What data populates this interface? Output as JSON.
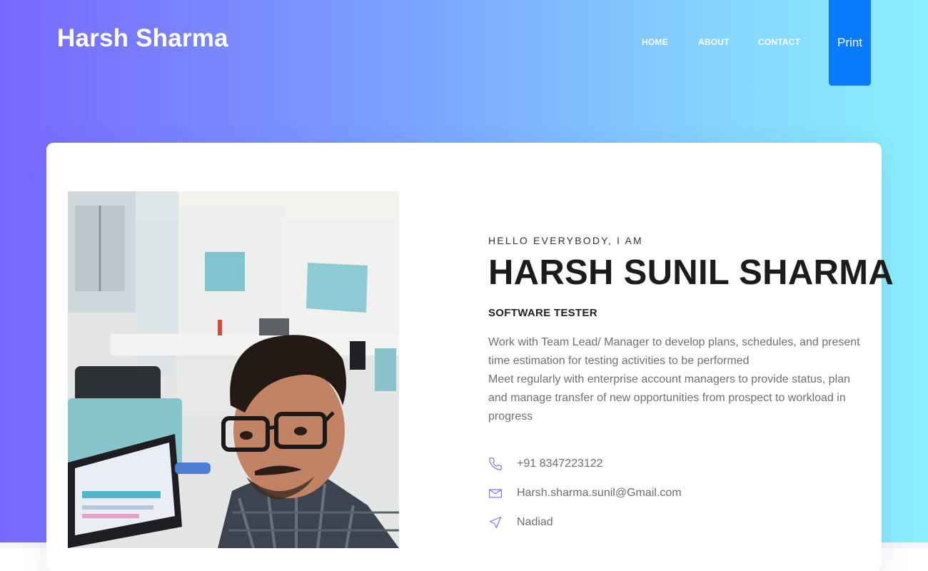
{
  "brand": "Harsh Sharma",
  "nav": {
    "home": "HOME",
    "about": "ABOUT",
    "contact": "CONTACT",
    "print": "Print"
  },
  "profile": {
    "greeting": "HELLO EVERYBODY, I AM",
    "name": "HARSH SUNIL SHARMA",
    "role": "SOFTWARE TESTER",
    "description_1": "Work with Team Lead/ Manager to develop plans, schedules, and present time estimation for testing activities to be performed",
    "description_2": "Meet regularly with enterprise account managers to provide status, plan and manage transfer of new opportunities from prospect to workload in progress"
  },
  "contact": {
    "phone": "+91 8347223122",
    "email": "Harsh.sharma.sunil@Gmail.com",
    "location": "Nadiad"
  },
  "icons": {
    "phone": "phone-icon",
    "email": "envelope-icon",
    "location": "navigation-arrow-icon"
  },
  "colors": {
    "gradient_start": "#7868ff",
    "gradient_end": "#8aeffd",
    "print_button": "#0a7bff",
    "icon_accent": "#7b6ff0"
  }
}
